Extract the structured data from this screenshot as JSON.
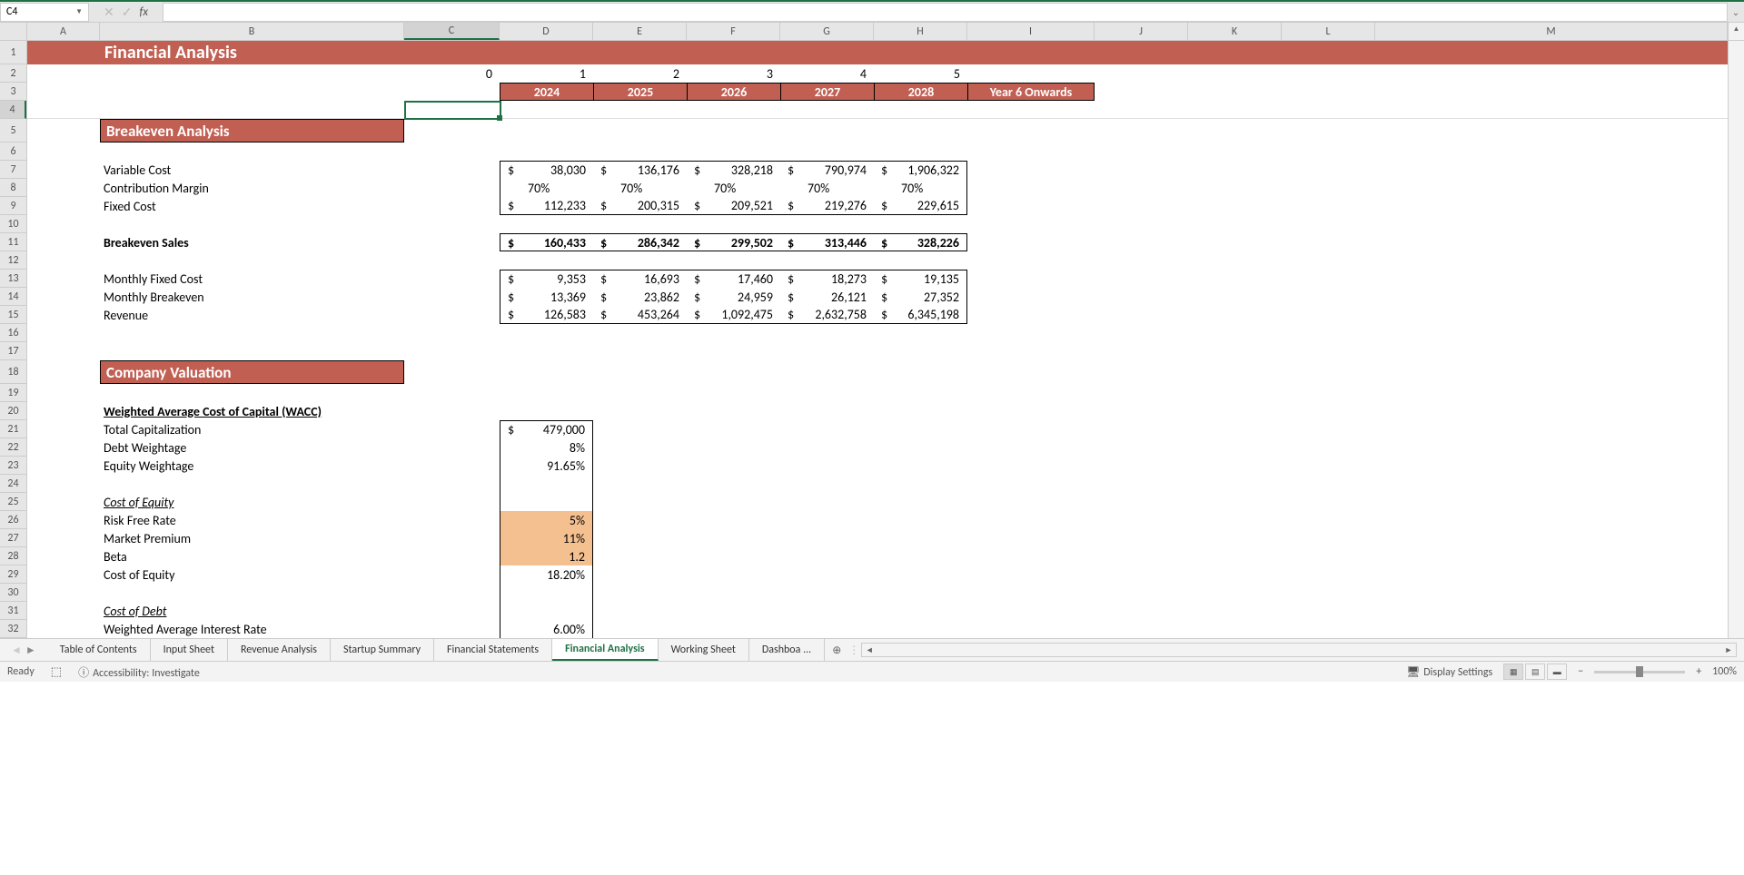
{
  "nameBox": "C4",
  "formulaBar": "",
  "columns": [
    "A",
    "B",
    "C",
    "D",
    "E",
    "F",
    "G",
    "H",
    "I",
    "J",
    "K",
    "L",
    "M"
  ],
  "rowNumbers": [
    1,
    2,
    3,
    4,
    5,
    6,
    7,
    8,
    9,
    10,
    11,
    12,
    13,
    14,
    15,
    16,
    17,
    18,
    19,
    20,
    21,
    22,
    23,
    24,
    25,
    26,
    27,
    28,
    29,
    30,
    31,
    32
  ],
  "selectedCell": "C4",
  "title": "Financial Analysis",
  "scenarioNumbers": [
    "0",
    "1",
    "2",
    "3",
    "4",
    "5"
  ],
  "yearHeaders": [
    "2024",
    "2025",
    "2026",
    "2027",
    "2028",
    "Year 6 Onwards"
  ],
  "sections": {
    "breakeven": "Breakeven Analysis",
    "valuation": "Company Valuation"
  },
  "labels": {
    "variableCost": "Variable Cost",
    "contributionMargin": "Contribution Margin",
    "fixedCost": "Fixed Cost",
    "breakevenSales": "Breakeven Sales",
    "monthlyFixedCost": "Monthly Fixed Cost",
    "monthlyBreakeven": "Monthly Breakeven",
    "revenue": "Revenue",
    "wacc": "Weighted Average Cost of Capital (WACC)",
    "totalCap": "Total Capitalization",
    "debtWeightage": "Debt Weightage",
    "equityWeightage": "Equity Weightage",
    "costOfEquity": "Cost of Equity",
    "riskFreeRate": "Risk Free Rate",
    "marketPremium": "Market Premium",
    "beta": "Beta",
    "costOfEquityVal": "Cost of Equity",
    "costOfDebt": "Cost of Debt",
    "wair": "Weighted Average Interest Rate"
  },
  "data": {
    "variableCost": [
      "38,030",
      "136,176",
      "328,218",
      "790,974",
      "1,906,322"
    ],
    "contributionMargin": [
      "70%",
      "70%",
      "70%",
      "70%",
      "70%"
    ],
    "fixedCost": [
      "112,233",
      "200,315",
      "209,521",
      "219,276",
      "229,615"
    ],
    "breakevenSales": [
      "160,433",
      "286,342",
      "299,502",
      "313,446",
      "328,226"
    ],
    "monthlyFixedCost": [
      "9,353",
      "16,693",
      "17,460",
      "18,273",
      "19,135"
    ],
    "monthlyBreakeven": [
      "13,369",
      "23,862",
      "24,959",
      "26,121",
      "27,352"
    ],
    "revenue": [
      "126,583",
      "453,264",
      "1,092,475",
      "2,632,758",
      "6,345,198"
    ],
    "totalCap": "479,000",
    "debtWeightage": "8%",
    "equityWeightage": "91.65%",
    "riskFreeRate": "5%",
    "marketPremium": "11%",
    "beta": "1.2",
    "costOfEquity": "18.20%",
    "wair": "6.00%"
  },
  "tabs": [
    "Table of Contents",
    "Input Sheet",
    "Revenue Analysis",
    "Startup Summary",
    "Financial Statements",
    "Financial Analysis",
    "Working Sheet",
    "Dashboa ..."
  ],
  "activeTab": "Financial Analysis",
  "statusBar": {
    "ready": "Ready",
    "accessibility": "Accessibility: Investigate",
    "displaySettings": "Display Settings",
    "zoom": "100%"
  },
  "chart_data": {
    "type": "table",
    "title": "Financial Analysis - Breakeven Analysis",
    "categories": [
      "2024",
      "2025",
      "2026",
      "2027",
      "2028"
    ],
    "series": [
      {
        "name": "Variable Cost",
        "values": [
          38030,
          136176,
          328218,
          790974,
          1906322
        ]
      },
      {
        "name": "Contribution Margin (%)",
        "values": [
          70,
          70,
          70,
          70,
          70
        ]
      },
      {
        "name": "Fixed Cost",
        "values": [
          112233,
          200315,
          209521,
          219276,
          229615
        ]
      },
      {
        "name": "Breakeven Sales",
        "values": [
          160433,
          286342,
          299502,
          313446,
          328226
        ]
      },
      {
        "name": "Monthly Fixed Cost",
        "values": [
          9353,
          16693,
          17460,
          18273,
          19135
        ]
      },
      {
        "name": "Monthly Breakeven",
        "values": [
          13369,
          23862,
          24959,
          26121,
          27352
        ]
      },
      {
        "name": "Revenue",
        "values": [
          126583,
          453264,
          1092475,
          2632758,
          6345198
        ]
      }
    ],
    "wacc_inputs": {
      "Total Capitalization": 479000,
      "Debt Weightage": 0.08,
      "Equity Weightage": 0.9165,
      "Risk Free Rate": 0.05,
      "Market Premium": 0.11,
      "Beta": 1.2,
      "Cost of Equity": 0.182,
      "Weighted Average Interest Rate": 0.06
    }
  }
}
